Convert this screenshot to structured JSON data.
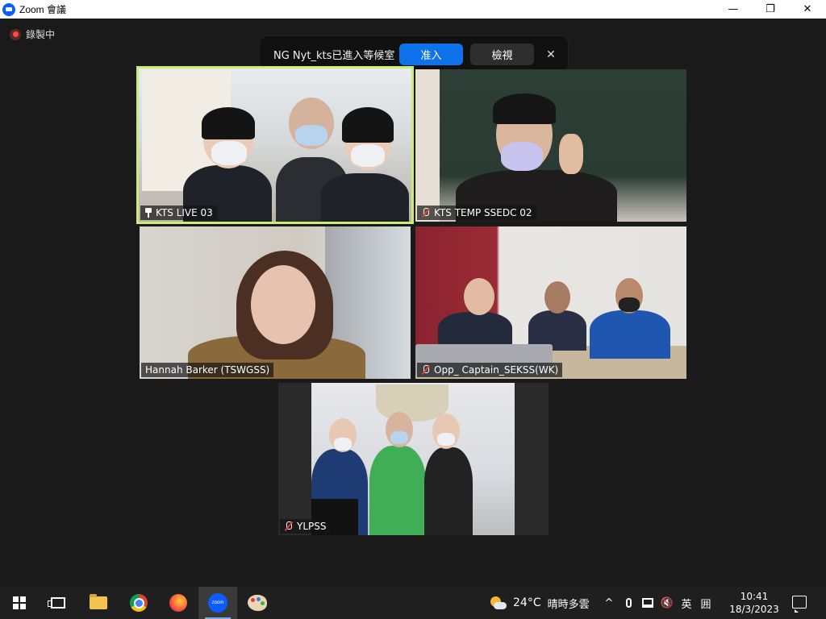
{
  "window": {
    "title": "Zoom 會議",
    "minimize": "—",
    "maximize": "❐",
    "close": "✕"
  },
  "recording": {
    "label": "錄製中"
  },
  "notification": {
    "message": "NG Nyt_kts已進入等候室",
    "admit_label": "准入",
    "view_label": "檢視",
    "close_label": "✕"
  },
  "tiles": [
    {
      "name": "KTS LIVE 03",
      "pinned": true,
      "muted": false,
      "active_speaker": true
    },
    {
      "name": "KTS TEMP SSEDC 02",
      "pinned": false,
      "muted": true
    },
    {
      "name": "Hannah Barker (TSWGSS)",
      "pinned": false,
      "muted": false
    },
    {
      "name": "Opp_ Captain_SEKSS(WK)",
      "pinned": false,
      "muted": true
    },
    {
      "name": "YLPSS",
      "pinned": false,
      "muted": true
    }
  ],
  "taskbar": {
    "apps": [
      "start-icon",
      "task-view-icon",
      "file-explorer-icon",
      "chrome-icon",
      "firefox-icon",
      "zoom-icon",
      "paint-icon"
    ],
    "active_app": "zoom-icon",
    "zoom_label": "zoom",
    "weather": {
      "temp": "24°C",
      "condition": "晴時多雲"
    },
    "tray": {
      "chevron": "^",
      "ime": "英",
      "ime2": "囲",
      "volume": "🔇"
    },
    "clock": {
      "time": "10:41",
      "date": "18/3/2023"
    }
  },
  "colors": {
    "active_speaker_border": "#c9ec7a",
    "admit_button": "#0e72ed",
    "zoom_blue": "#0b5cff",
    "recording_red": "#ff4a3d",
    "muted_red": "#e03e3e"
  }
}
